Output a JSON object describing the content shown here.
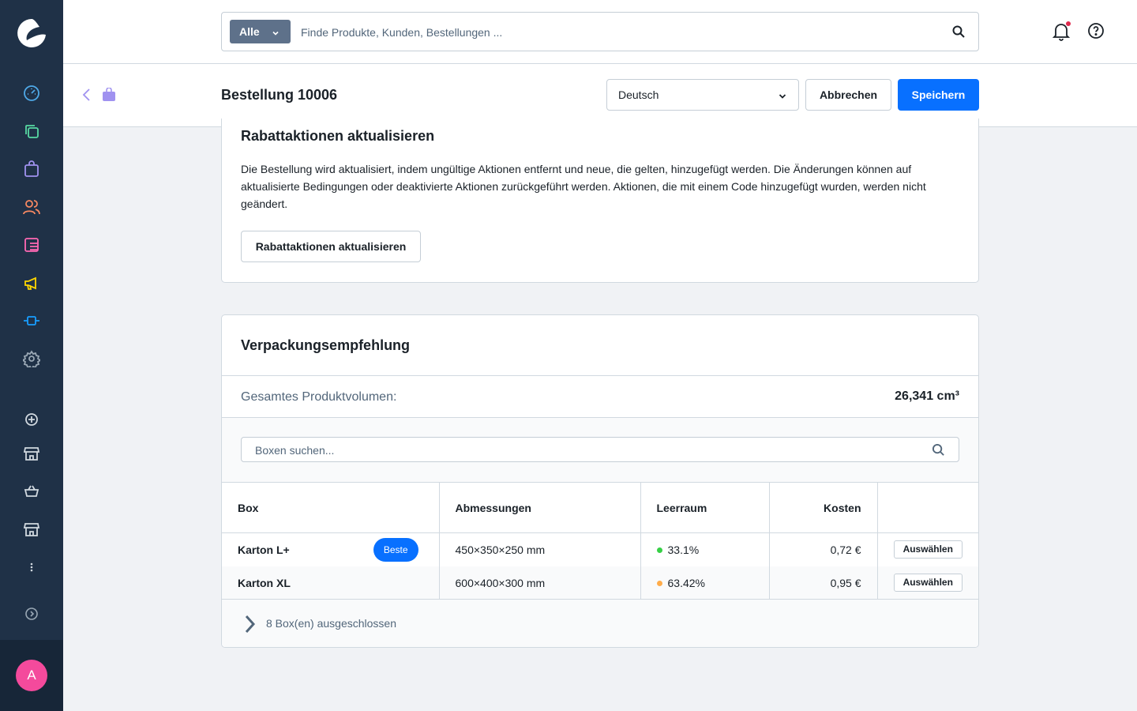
{
  "colors": {
    "sidebar": "#1f3147",
    "accent": "#0870ff",
    "avatar": "#f44a9c",
    "status_good": "#37d046",
    "status_warn": "#ffac4a"
  },
  "header": {
    "search_type": "Alle",
    "search_placeholder": "Finde Produkte, Kunden, Bestellungen ...",
    "icons": [
      "search-icon",
      "bell-icon",
      "help-icon"
    ]
  },
  "sidebar": {
    "icons": [
      "dashboard-icon",
      "catalogue-icon",
      "orders-icon",
      "customers-icon",
      "content-icon",
      "marketing-icon",
      "extensions-icon",
      "settings-icon",
      "add-icon",
      "sales-channel-icon",
      "basket-icon",
      "storefront-icon",
      "more-icon",
      "expand-icon"
    ],
    "avatar_initial": "A"
  },
  "smartbar": {
    "title": "Bestellung 10006",
    "language": "Deutsch",
    "cancel_label": "Abbrechen",
    "save_label": "Speichern"
  },
  "promotions": {
    "title": "Rabattaktionen aktualisieren",
    "description": "Die Bestellung wird aktualisiert, indem ungültige Aktionen entfernt und neue, die gelten, hinzugefügt werden. Die Änderungen können auf aktualisierte Bedingungen oder deaktivierte Aktionen zurückgeführt werden. Aktionen, die mit einem Code hinzugefügt wurden, werden nicht geändert.",
    "button_label": "Rabattaktionen aktualisieren"
  },
  "packaging": {
    "title": "Verpackungsempfehlung",
    "volume_label": "Gesamtes Produktvolumen:",
    "volume_value": "26,341 cm³",
    "search_placeholder": "Boxen suchen...",
    "columns": [
      "Box",
      "Abmessungen",
      "Leerraum",
      "Kosten"
    ],
    "rows": [
      {
        "box": "Karton L+",
        "badge": "Beste",
        "dimensions": "450×350×250 mm",
        "void": "33.1%",
        "void_status": "good",
        "cost": "0,72 €",
        "action": "Auswählen"
      },
      {
        "box": "Karton XL",
        "badge": "",
        "dimensions": "600×400×300 mm",
        "void": "63.42%",
        "void_status": "warn",
        "cost": "0,95 €",
        "action": "Auswählen"
      }
    ],
    "excluded_label": "8 Box(en) ausgeschlossen"
  }
}
